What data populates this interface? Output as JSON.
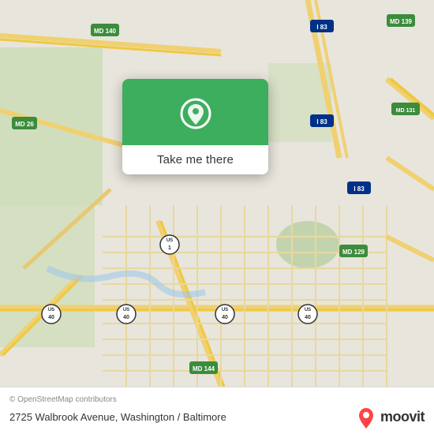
{
  "map": {
    "background_color": "#e8e0d8",
    "alt_text": "Map of Washington / Baltimore area"
  },
  "popup": {
    "button_label": "Take me there",
    "pin_color": "#ffffff",
    "background_color": "#3dae5e"
  },
  "bottom_bar": {
    "copyright": "© OpenStreetMap contributors",
    "address": "2725 Walbrook Avenue, Washington / Baltimore",
    "moovit_label": "moovit"
  }
}
